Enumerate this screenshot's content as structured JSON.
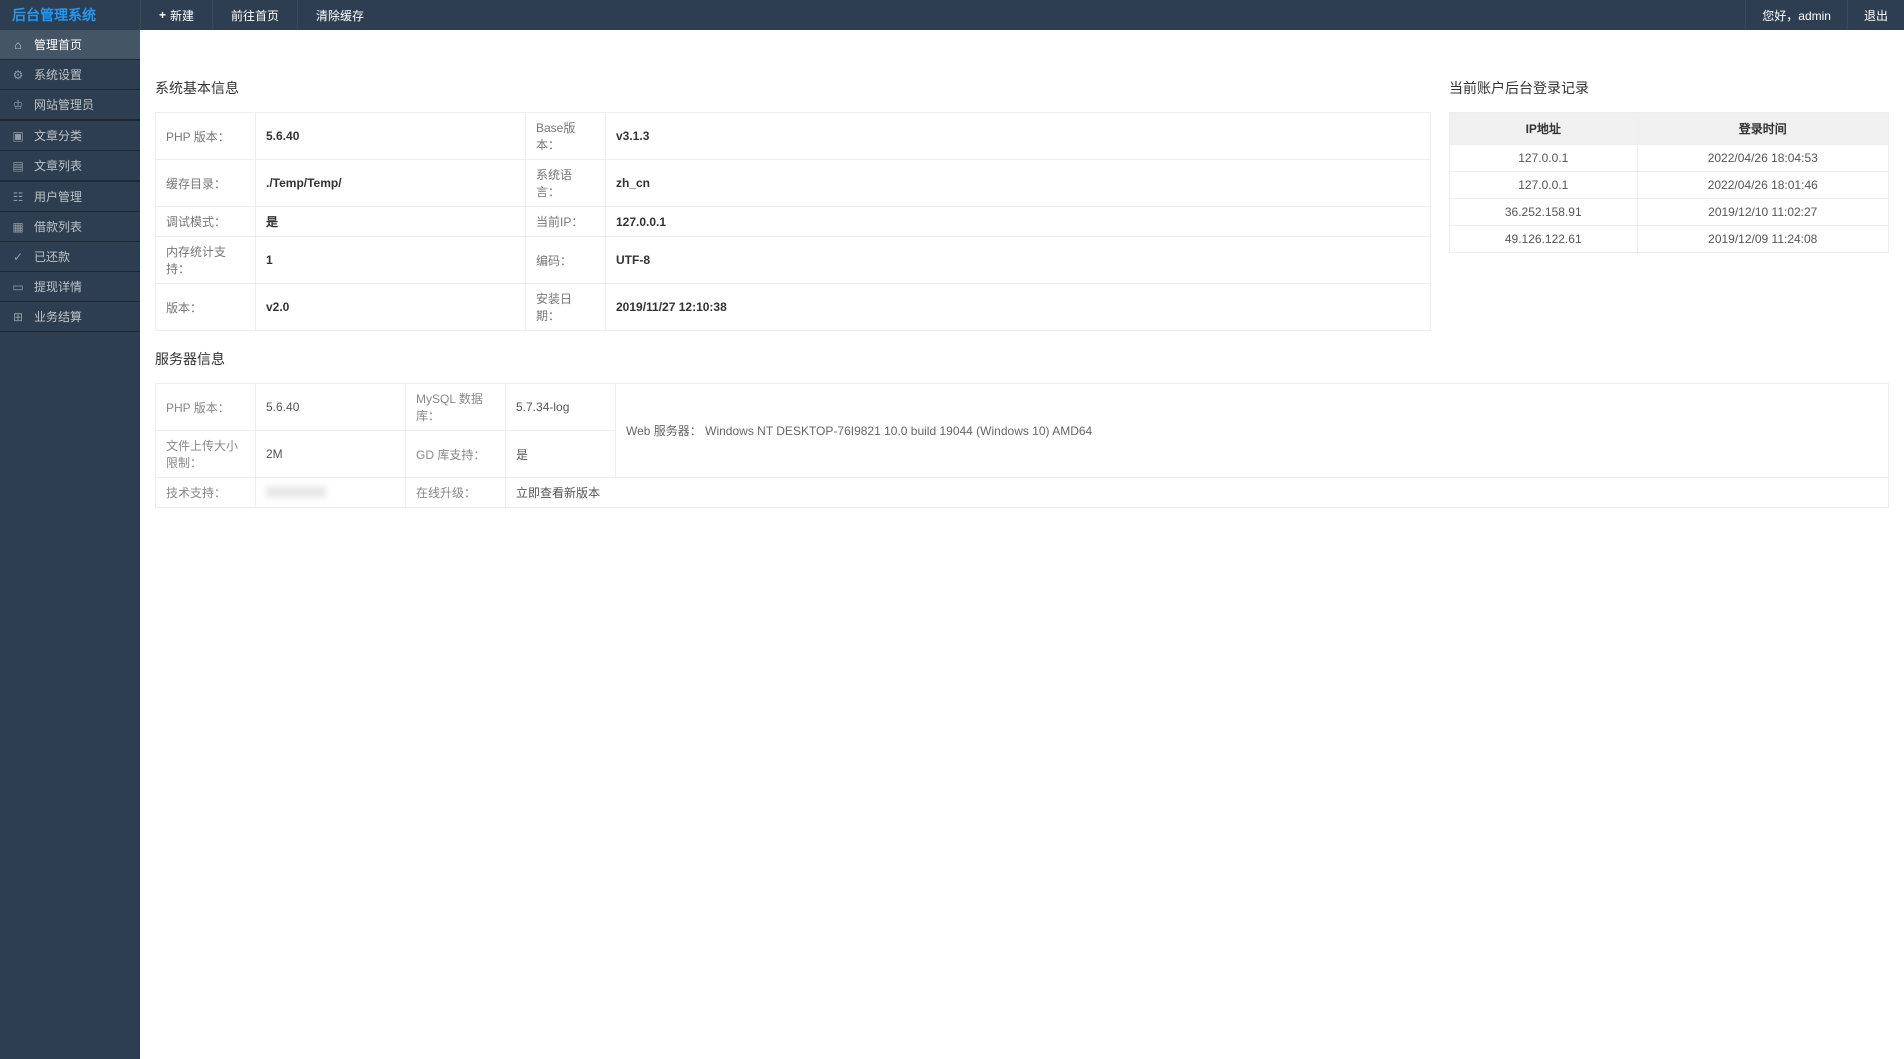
{
  "header": {
    "logo": "后台管理系统",
    "nav": {
      "new": "新建",
      "home": "前往首页",
      "clear_cache": "清除缓存"
    },
    "greeting": "您好，admin",
    "logout": "退出"
  },
  "sidebar": {
    "items": [
      {
        "label": "管理首页",
        "icon": "home",
        "active": true
      },
      {
        "label": "系统设置",
        "icon": "gear"
      },
      {
        "label": "网站管理员",
        "icon": "user"
      },
      {
        "label": "文章分类",
        "icon": "folder"
      },
      {
        "label": "文章列表",
        "icon": "doc"
      },
      {
        "label": "用户管理",
        "icon": "users"
      },
      {
        "label": "借款列表",
        "icon": "grid"
      },
      {
        "label": "已还款",
        "icon": "check"
      },
      {
        "label": "提现详情",
        "icon": "card"
      },
      {
        "label": "业务结算",
        "icon": "calc"
      }
    ]
  },
  "sections": {
    "system_info_title": "系统基本信息",
    "login_records_title": "当前账户后台登录记录",
    "server_info_title": "服务器信息"
  },
  "system_info": {
    "rows": [
      {
        "l1": "PHP 版本：",
        "v1": "5.6.40",
        "l2": "Base版本：",
        "v2": "v3.1.3"
      },
      {
        "l1": "缓存目录：",
        "v1": "./Temp/Temp/",
        "l2": "系统语言：",
        "v2": "zh_cn"
      },
      {
        "l1": "调试模式：",
        "v1": "是",
        "l2": "当前IP：",
        "v2": "127.0.0.1"
      },
      {
        "l1": "内存统计支持：",
        "v1": "1",
        "l2": "编码：",
        "v2": "UTF-8"
      },
      {
        "l1": "版本：",
        "v1": "v2.0",
        "l2": "安装日期：",
        "v2": "2019/11/27 12:10:38"
      }
    ]
  },
  "login_records": {
    "columns": {
      "ip": "IP地址",
      "time": "登录时间"
    },
    "rows": [
      {
        "ip": "127.0.0.1",
        "time": "2022/04/26 18:04:53"
      },
      {
        "ip": "127.0.0.1",
        "time": "2022/04/26 18:01:46"
      },
      {
        "ip": "36.252.158.91",
        "time": "2019/12/10 11:02:27"
      },
      {
        "ip": "49.126.122.61",
        "time": "2019/12/09 11:24:08"
      }
    ]
  },
  "server_info": {
    "php_label": "PHP 版本：",
    "php_value": "5.6.40",
    "mysql_label": "MySQL 数据库：",
    "mysql_value": "5.7.34-log",
    "upload_label": "文件上传大小限制：",
    "upload_value": "2M",
    "gd_label": "GD 库支持：",
    "gd_value": "是",
    "web_server_label": "Web 服务器：",
    "web_server_value": "Windows NT DESKTOP-76I9821 10.0 build 19044 (Windows 10) AMD64",
    "tech_support_label": "技术支持：",
    "upgrade_label": "在线升级：",
    "upgrade_link": "立即查看新版本"
  }
}
